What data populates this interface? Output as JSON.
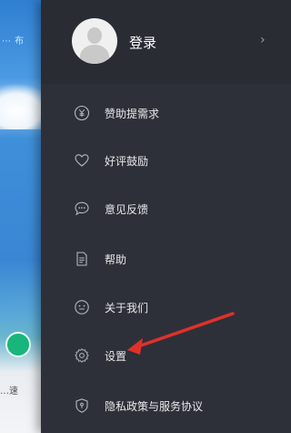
{
  "background": {
    "text_top": "⋯ 布",
    "text_bottom": "…速",
    "accent": "#18b57c"
  },
  "drawer": {
    "login_label": "登录",
    "chevron": "›",
    "items": [
      {
        "label": "赞助提需求",
        "icon": "yen-coin-icon"
      },
      {
        "label": "好评鼓励",
        "icon": "heart-icon"
      },
      {
        "label": "意见反馈",
        "icon": "chat-bubble-icon"
      },
      {
        "label": "帮助",
        "icon": "document-icon"
      },
      {
        "label": "关于我们",
        "icon": "face-icon"
      },
      {
        "label": "设置",
        "icon": "gear-icon"
      },
      {
        "label": "隐私政策与服务协议",
        "icon": "shield-icon"
      }
    ],
    "colors": {
      "drawer_bg": "#2e3039",
      "text": "#e8e8ea",
      "annotation_arrow": "#e0312b"
    }
  }
}
